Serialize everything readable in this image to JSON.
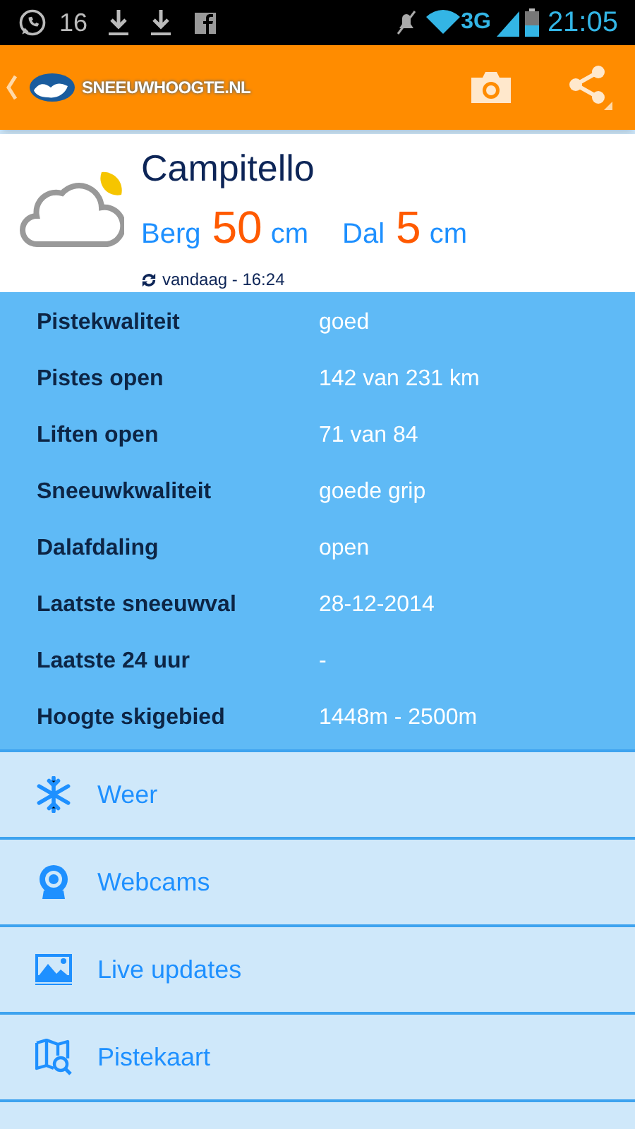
{
  "status_bar": {
    "notification_count": "16",
    "network": "3G",
    "time": "21:05"
  },
  "header": {
    "logo_text": "SNEEUWHOOGTE.NL"
  },
  "resort": {
    "name": "Campitello",
    "mountain_label": "Berg",
    "mountain_value": "50",
    "mountain_unit": "cm",
    "valley_label": "Dal",
    "valley_value": "5",
    "valley_unit": "cm",
    "updated": "vandaag - 16:24"
  },
  "details": [
    {
      "label": "Pistekwaliteit",
      "value": "goed"
    },
    {
      "label": "Pistes open",
      "value": "142 van 231 km"
    },
    {
      "label": "Liften open",
      "value": "71 van 84"
    },
    {
      "label": "Sneeuwkwaliteit",
      "value": "goede grip"
    },
    {
      "label": "Dalafdaling",
      "value": "open"
    },
    {
      "label": "Laatste sneeuwval",
      "value": "28-12-2014"
    },
    {
      "label": "Laatste 24 uur",
      "value": "-"
    },
    {
      "label": "Hoogte skigebied",
      "value": "1448m - 2500m"
    }
  ],
  "menu": [
    {
      "kind": "weather",
      "label": "Weer"
    },
    {
      "kind": "webcam",
      "label": "Webcams"
    },
    {
      "kind": "photo",
      "label": "Live updates"
    },
    {
      "kind": "map",
      "label": "Pistekaart"
    }
  ]
}
